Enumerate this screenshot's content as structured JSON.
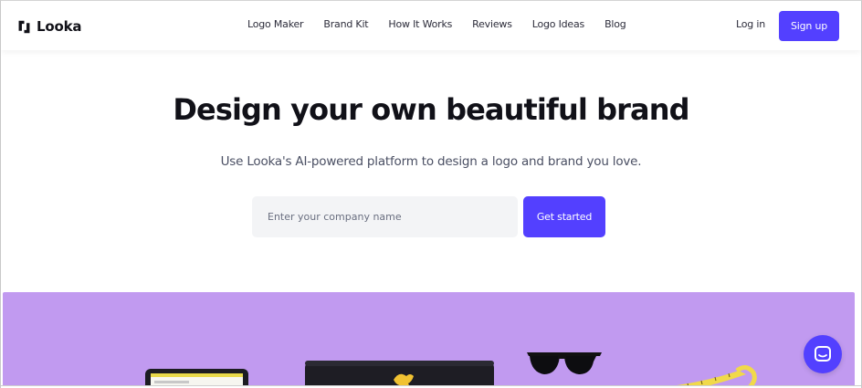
{
  "header": {
    "brand": "Looka",
    "nav": [
      {
        "label": "Logo Maker"
      },
      {
        "label": "Brand Kit"
      },
      {
        "label": "How It Works"
      },
      {
        "label": "Reviews"
      },
      {
        "label": "Logo Ideas"
      },
      {
        "label": "Blog"
      }
    ],
    "login_label": "Log in",
    "signup_label": "Sign up"
  },
  "hero": {
    "title": "Design your own beautiful brand",
    "subtitle": "Use Looka's AI-powered platform to design a logo and brand you love.",
    "input_placeholder": "Enter your company name",
    "input_value": "",
    "cta_label": "Get started"
  },
  "banner": {
    "background": "#c19af0",
    "items": [
      "tablet",
      "rolled-banner",
      "sunglasses",
      "measuring-tape"
    ]
  },
  "colors": {
    "accent": "#5340ff",
    "text": "#111118",
    "muted": "#4a4f63",
    "input_bg": "#f3f4f6"
  },
  "icons": {
    "brand": "looka-logo-icon",
    "chat": "chat-icon"
  }
}
